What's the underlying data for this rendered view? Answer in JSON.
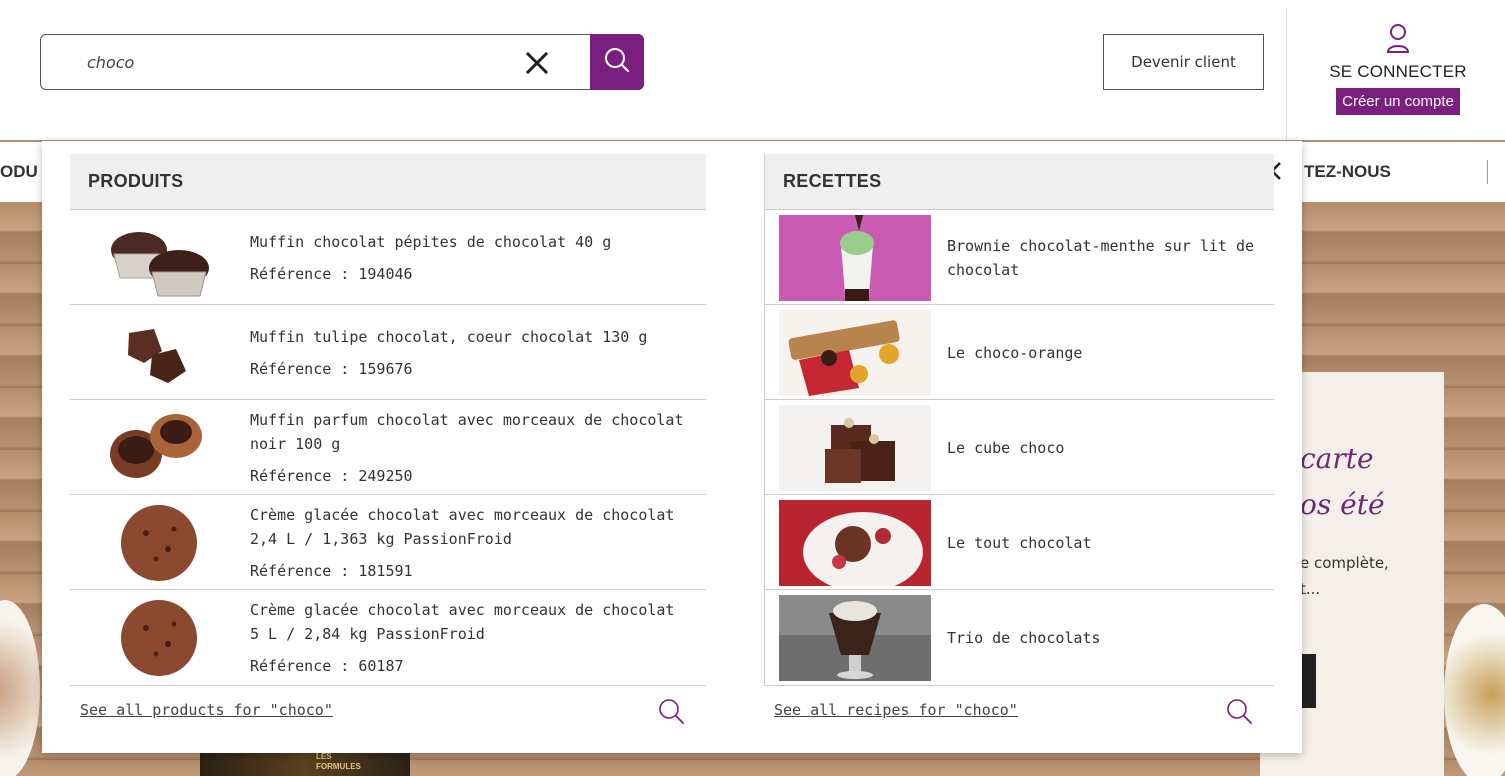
{
  "search": {
    "value": "choco",
    "clear_icon": "close-icon",
    "submit_icon": "search-icon"
  },
  "header": {
    "devenir_client": "Devenir client",
    "connect_label": "SE CONNECTER",
    "create_account": "Créer un compte",
    "user_icon": "user-icon"
  },
  "nav": {
    "left_partial": "ODU",
    "right_partial": "TEZ-NOUS"
  },
  "promo": {
    "title": "carte\nos été",
    "text": "e complète,\nt...",
    "bottom_product_text": "LES\nFORMULES"
  },
  "dropdown": {
    "close_icon": "close-icon",
    "products": {
      "heading": "PRODUITS",
      "items": [
        {
          "name": "Muffin chocolat pépites de chocolat 40 g",
          "ref": "Référence : 194046"
        },
        {
          "name": "Muffin tulipe chocolat, coeur chocolat 130 g",
          "ref": "Référence : 159676"
        },
        {
          "name": "Muffin parfum chocolat avec morceaux de chocolat noir 100 g",
          "ref": "Référence : 249250"
        },
        {
          "name": "Crème glacée chocolat avec morceaux de chocolat 2,4 L / 1,363 kg PassionFroid",
          "ref": "Référence : 181591"
        },
        {
          "name": "Crème glacée chocolat avec morceaux de chocolat 5 L / 2,84 kg PassionFroid",
          "ref": "Référence : 60187"
        }
      ],
      "see_all": "See all products for \"choco\""
    },
    "recipes": {
      "heading": "RECETTES",
      "items": [
        {
          "name": "Brownie chocolat-menthe sur lit de chocolat"
        },
        {
          "name": "Le choco-orange"
        },
        {
          "name": "Le cube choco"
        },
        {
          "name": "Le tout chocolat"
        },
        {
          "name": "Trio de chocolats"
        }
      ],
      "see_all": "See all recipes for \"choco\""
    }
  },
  "colors": {
    "brand_purple": "#7a1f7e",
    "header_bg": "#efefef",
    "border": "#cccccc"
  }
}
